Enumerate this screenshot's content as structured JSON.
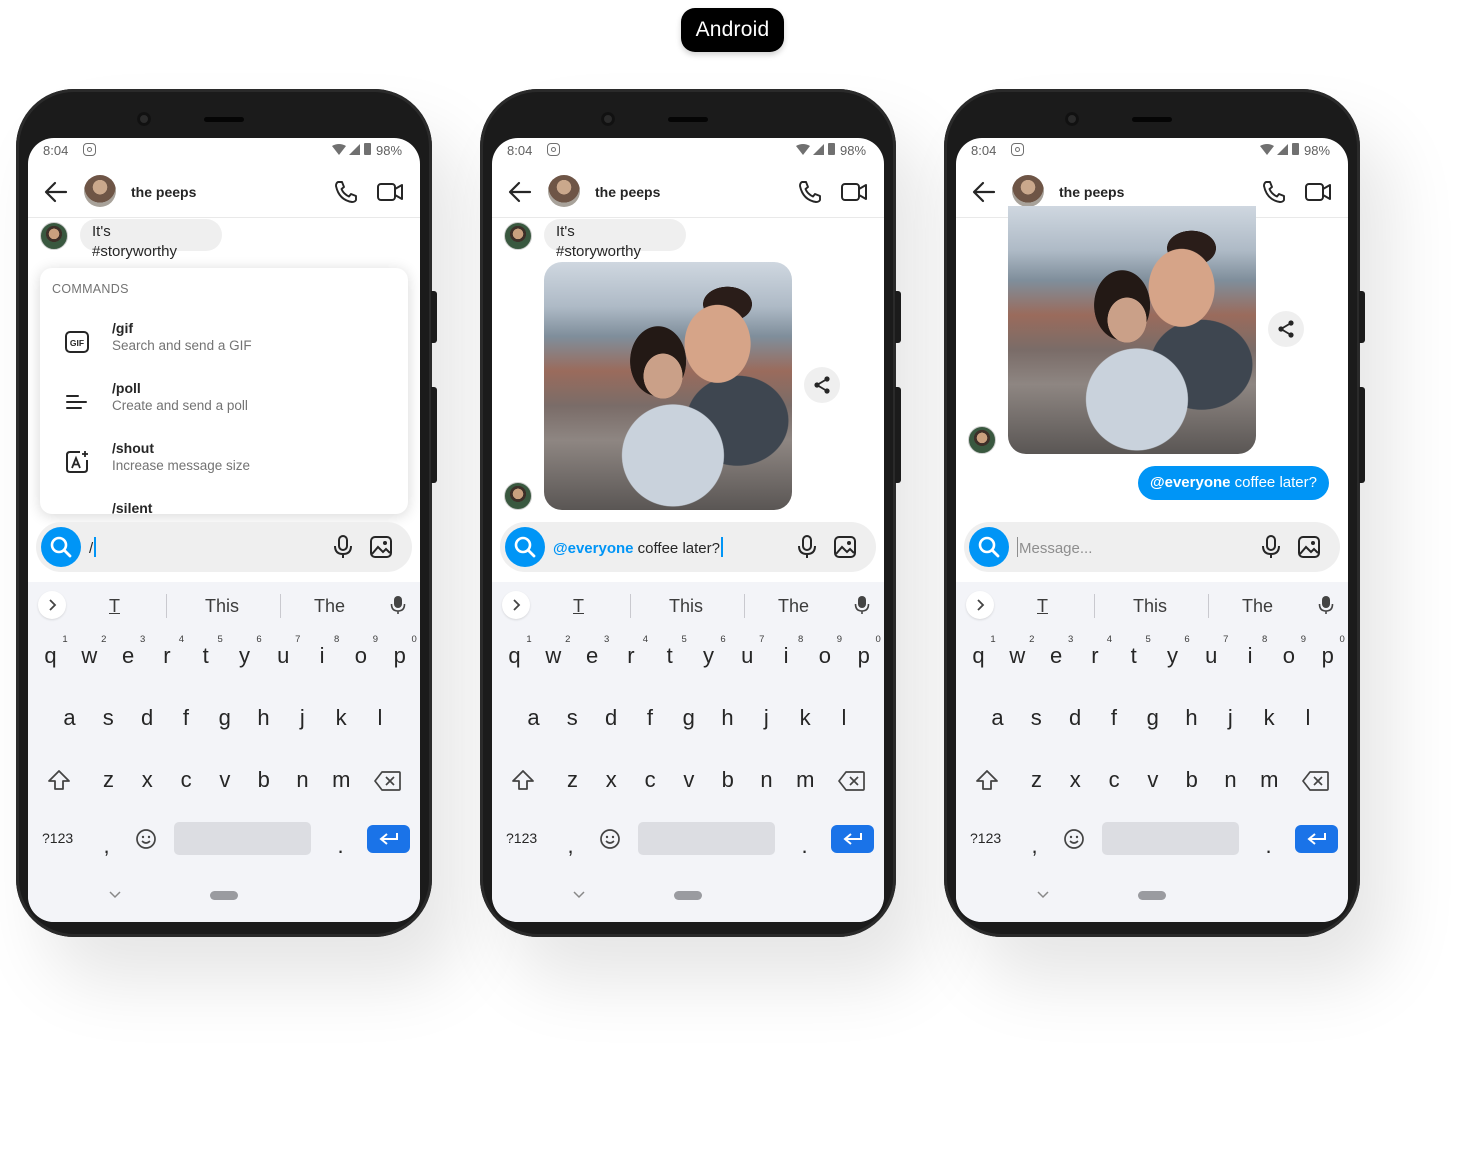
{
  "platform_label": "Android",
  "status_bar": {
    "time": "8:04",
    "battery": "98%"
  },
  "chat": {
    "title": "the peeps"
  },
  "messages": {
    "incoming_text": "It's\n#storyworthy",
    "outgoing_mention": "@everyone",
    "outgoing_rest": " coffee later?"
  },
  "commands": {
    "heading": "COMMANDS",
    "items": [
      {
        "name": "/gif",
        "desc": "Search and send a GIF",
        "icon": "gif-icon"
      },
      {
        "name": "/poll",
        "desc": "Create and send a poll",
        "icon": "poll-icon"
      },
      {
        "name": "/shout",
        "desc": "Increase message size",
        "icon": "shout-icon"
      },
      {
        "name": "/silent",
        "desc": "",
        "icon": "silent-icon"
      }
    ]
  },
  "composer": {
    "phone1_text": "/",
    "phone2_mention": "@everyone",
    "phone2_rest": " coffee later?",
    "placeholder": "Message..."
  },
  "keyboard": {
    "suggestions": [
      "T",
      "This",
      "The"
    ],
    "row1": [
      "q",
      "w",
      "e",
      "r",
      "t",
      "y",
      "u",
      "i",
      "o",
      "p"
    ],
    "row1_hints": [
      "1",
      "2",
      "3",
      "4",
      "5",
      "6",
      "7",
      "8",
      "9",
      "0"
    ],
    "row2": [
      "a",
      "s",
      "d",
      "f",
      "g",
      "h",
      "j",
      "k",
      "l"
    ],
    "row3": [
      "z",
      "x",
      "c",
      "v",
      "b",
      "n",
      "m"
    ],
    "symbols_key": "?123",
    "comma_key": ",",
    "period_key": "."
  },
  "colors": {
    "accent": "#0095f6",
    "enter_key": "#1a73e8",
    "keyboard_bg": "#f3f4f8",
    "bubble_incoming": "#efefef"
  }
}
